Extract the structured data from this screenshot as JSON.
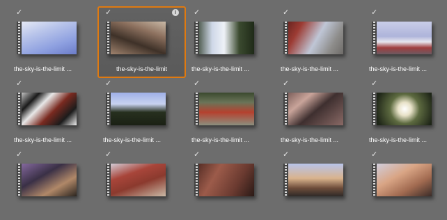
{
  "clips": [
    {
      "label": "the-sky-is-the-limit ...",
      "selected": false,
      "info": false,
      "img": "linear-gradient(160deg,#e9ecf6 0%,#b8c4ea 35%,#8ea0e0 70%,#6b7cc8 100%)"
    },
    {
      "label": "the-sky-is-the-limit",
      "selected": true,
      "info": true,
      "img": "linear-gradient(200deg,#c9b9a6 0%,#8c705e 30%,#3e3128 60%,#a88a74 100%)"
    },
    {
      "label": "the-sky-is-the-limit ...",
      "selected": false,
      "info": false,
      "img": "linear-gradient(90deg,#2a3722 0%,#cfd8e8 30%,#eef1f7 50%,#3b4a2f 75%,#1f2a18 100%)"
    },
    {
      "label": "the-sky-is-the-limit ...",
      "selected": false,
      "info": false,
      "img": "linear-gradient(120deg,#5a1e1a 0%,#9c3b33 25%,#bfc6d6 55%,#8d8c8a 80%,#6e6b68 100%)"
    },
    {
      "label": "the-sky-is-the-limit ...",
      "selected": false,
      "info": false,
      "img": "linear-gradient(180deg,#c9cde8 0%,#aeb4da 45%,#e7e7ef 62%,#a03e3e 80%,#6c5a62 100%)"
    },
    {
      "label": "the-sky-is-the-limit ...",
      "selected": false,
      "info": false,
      "img": "linear-gradient(135deg,#f0f0f0 0%,#1a1a1a 25%,#e8e8e8 40%,#7a2a20 60%,#1c1c1c 80%,#efefef 100%)"
    },
    {
      "label": "the-sky-is-the-limit ...",
      "selected": false,
      "info": false,
      "img": "linear-gradient(180deg,#9fb0e8 0%,#c8d2f0 35%,#27301f 60%,#1a2014 100%)"
    },
    {
      "label": "the-sky-is-the-limit ...",
      "selected": false,
      "info": false,
      "img": "linear-gradient(180deg,#3b4a2f 0%,#6a7458 30%,#b5412f 60%,#8b8f7e 100%)"
    },
    {
      "label": "the-sky-is-the-limit ...",
      "selected": false,
      "info": false,
      "img": "linear-gradient(140deg,#6f5350 0%,#c9a49a 30%,#3e2f2f 55%,#8a6a66 100%)"
    },
    {
      "label": "the-sky-is-the-limit ...",
      "selected": false,
      "info": false,
      "img": "radial-gradient(circle at 55% 50%,#ffffff 0%,#e8e2c8 18%,#5d6a40 40%,#1f2618 80%)"
    },
    {
      "label": "",
      "selected": false,
      "info": false,
      "img": "linear-gradient(150deg,#8d6fa8 0%,#3a3046 40%,#b08868 70%,#2b2520 100%)"
    },
    {
      "label": "",
      "selected": false,
      "info": false,
      "img": "linear-gradient(160deg,#d7d9e6 0%,#a8453a 35%,#8b3a2e 60%,#c9b9a6 100%)"
    },
    {
      "label": "",
      "selected": false,
      "info": false,
      "img": "linear-gradient(120deg,#4a2620 0%,#9c5b4a 35%,#6a3a30 70%,#2a1a16 100%)"
    },
    {
      "label": "",
      "selected": false,
      "info": false,
      "img": "linear-gradient(180deg,#b8c4ea 0%,#d9b38d 45%,#6d4c3a 75%,#2f2a28 100%)"
    },
    {
      "label": "",
      "selected": false,
      "info": false,
      "img": "linear-gradient(150deg,#cfd2e6 0%,#d9a585 40%,#a16a50 70%,#3a2c28 100%)"
    }
  ],
  "icons": {
    "check": "check-icon",
    "info": "info-icon",
    "film": "filmstrip-icon"
  },
  "check_glyph": "✓",
  "info_glyph": "i",
  "accent": "#e07a10"
}
